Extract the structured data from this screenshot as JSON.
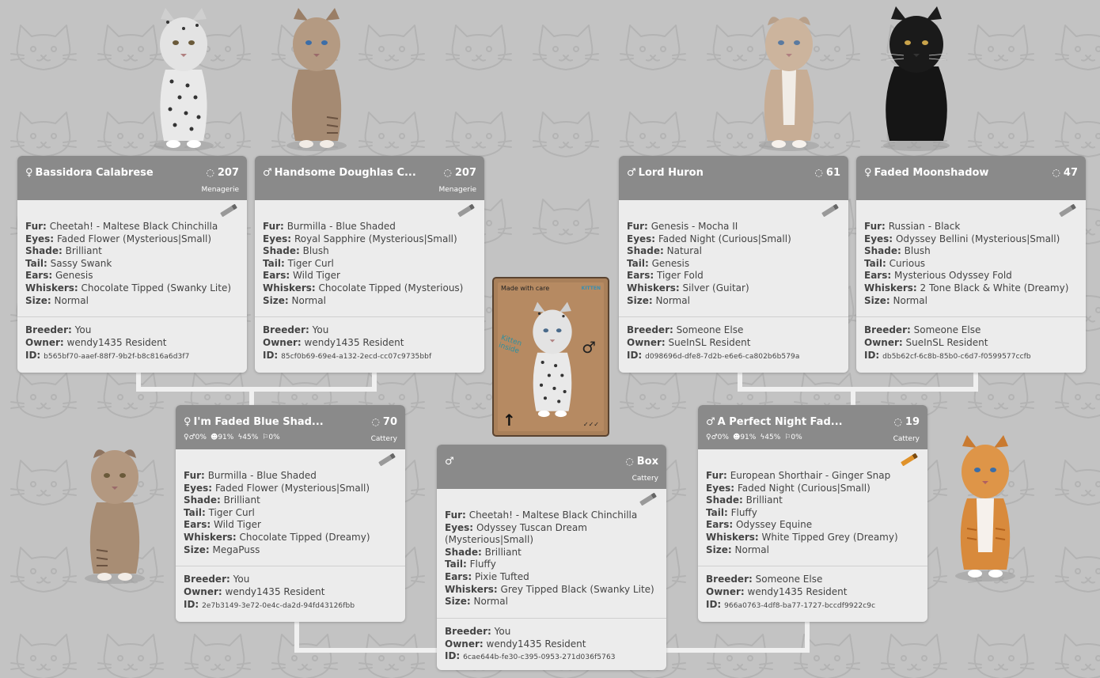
{
  "colors": {
    "background": "#c3c3c3",
    "card_header": "#8a8a8a",
    "card_body": "#ececec",
    "connector": "#f2f2f2"
  },
  "cards": {
    "gp1": {
      "gender": "♀",
      "name": "Bassidora Calabrese",
      "age": "207",
      "location": "Menagerie",
      "fur": "Cheetah! - Maltese Black Chinchilla",
      "eyes": "Faded Flower (Mysterious|Small)",
      "shade": "Brilliant",
      "tail": "Sassy Swank",
      "ears": "Genesis",
      "whiskers": "Chocolate Tipped (Swanky Lite)",
      "size": "Normal",
      "breeder": "You",
      "owner": "wendy1435 Resident",
      "id": "b565bf70-aaef-88f7-9b2f-b8c816a6d3f7"
    },
    "gp2": {
      "gender": "♂",
      "name": "Handsome Doughlas C...",
      "age": "207",
      "location": "Menagerie",
      "fur": "Burmilla - Blue Shaded",
      "eyes": "Royal Sapphire (Mysterious|Small)",
      "shade": "Blush",
      "tail": "Tiger Curl",
      "ears": "Wild Tiger",
      "whiskers": "Chocolate Tipped (Mysterious)",
      "size": "Normal",
      "breeder": "You",
      "owner": "wendy1435 Resident",
      "id": "85cf0b69-69e4-a132-2ecd-cc07c9735bbf"
    },
    "gp3": {
      "gender": "♂",
      "name": "Lord Huron",
      "age": "61",
      "location": "",
      "fur": "Genesis - Mocha II",
      "eyes": "Faded Night (Curious|Small)",
      "shade": "Natural",
      "tail": "Genesis",
      "ears": "Tiger Fold",
      "whiskers": "Silver (Guitar)",
      "size": "Normal",
      "breeder": "Someone Else",
      "owner": "SueInSL Resident",
      "id": "d098696d-dfe8-7d2b-e6e6-ca802b6b579a"
    },
    "gp4": {
      "gender": "♀",
      "name": "Faded Moonshadow",
      "age": "47",
      "location": "",
      "fur": "Russian - Black",
      "eyes": "Odyssey Bellini (Mysterious|Small)",
      "shade": "Blush",
      "tail": "Curious",
      "ears": "Mysterious Odyssey Fold",
      "whiskers": "2 Tone Black & White (Dreamy)",
      "size": "Normal",
      "breeder": "Someone Else",
      "owner": "SueInSL Resident",
      "id": "db5b62cf-6c8b-85b0-c6d7-f0599577ccfb"
    },
    "mother": {
      "gender": "♀",
      "name": "I'm Faded Blue Shad...",
      "age": "70",
      "location": "Cattery",
      "stat1": "♀♂0%",
      "stat2": "☻91%",
      "stat3": "ϟ45%",
      "stat4": "⚐0%",
      "fur": "Burmilla - Blue Shaded",
      "eyes": "Faded Flower (Mysterious|Small)",
      "shade": "Brilliant",
      "tail": "Tiger Curl",
      "ears": "Wild Tiger",
      "whiskers": "Chocolate Tipped (Dreamy)",
      "size": "MegaPuss",
      "breeder": "You",
      "owner": "wendy1435 Resident",
      "id": "2e7b3149-3e72-0e4c-da2d-94fd43126fbb"
    },
    "father": {
      "gender": "♂",
      "name": "A Perfect Night Fad...",
      "age": "19",
      "location": "Cattery",
      "stat1": "♀♂0%",
      "stat2": "☻91%",
      "stat3": "ϟ45%",
      "stat4": "⚐0%",
      "fur": "European Shorthair - Ginger Snap",
      "eyes": "Faded Night (Curious|Small)",
      "shade": "Brilliant",
      "tail": "Fluffy",
      "ears": "Odyssey Equine",
      "whiskers": "White Tipped Grey (Dreamy)",
      "size": "Normal",
      "breeder": "Someone Else",
      "owner": "wendy1435 Resident",
      "id": "966a0763-4df8-ba77-1727-bccdf9922c9c"
    },
    "kitten": {
      "gender": "♂",
      "name": "",
      "age": "Box",
      "location": "Cattery",
      "fur": "Cheetah! - Maltese Black Chinchilla",
      "eyes": "Odyssey Tuscan Dream (Mysterious|Small)",
      "shade": "Brilliant",
      "tail": "Fluffy",
      "ears": "Pixie Tufted",
      "whiskers": "Grey Tipped Black (Swanky Lite)",
      "size": "Normal",
      "breeder": "You",
      "owner": "wendy1435 Resident",
      "id": "6cae644b-fe30-c395-0953-271d036f5763"
    }
  },
  "labels": {
    "fur": "Fur:",
    "eyes": "Eyes:",
    "shade": "Shade:",
    "tail": "Tail:",
    "ears": "Ears:",
    "whiskers": "Whiskers:",
    "size": "Size:",
    "breeder": "Breeder:",
    "owner": "Owner:",
    "id": "ID:"
  },
  "box": {
    "top_text": "Made with care",
    "logo_text": "KITTEN",
    "inside_text": "Kitten inside",
    "gender": "♂",
    "arrow": "↑",
    "checks": "✓✓✓"
  }
}
